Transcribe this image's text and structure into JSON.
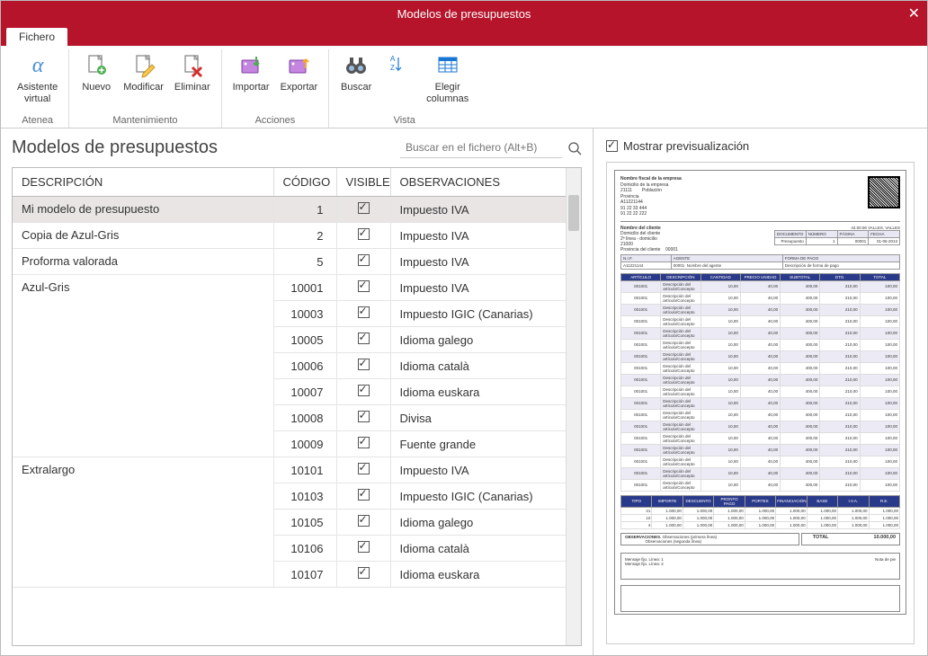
{
  "window": {
    "title": "Modelos de presupuestos"
  },
  "tab": {
    "label": "Fichero"
  },
  "ribbon": {
    "groups": [
      {
        "label": "Atenea",
        "items": [
          {
            "label": "Asistente\nvirtual",
            "name": "assistant-button",
            "icon": "alpha-icon"
          }
        ]
      },
      {
        "label": "Mantenimiento",
        "items": [
          {
            "label": "Nuevo",
            "name": "new-button",
            "icon": "new-icon"
          },
          {
            "label": "Modificar",
            "name": "edit-button",
            "icon": "edit-icon"
          },
          {
            "label": "Eliminar",
            "name": "delete-button",
            "icon": "delete-icon"
          }
        ]
      },
      {
        "label": "Acciones",
        "items": [
          {
            "label": "Importar",
            "name": "import-button",
            "icon": "import-icon"
          },
          {
            "label": "Exportar",
            "name": "export-button",
            "icon": "export-icon"
          }
        ]
      },
      {
        "label": "Vista",
        "items": [
          {
            "label": "Buscar",
            "name": "search-button",
            "icon": "binoculars-icon"
          },
          {
            "label": "",
            "name": "sort-button",
            "icon": "sort-icon"
          },
          {
            "label": "Elegir\ncolumnas",
            "name": "columns-button",
            "icon": "columns-icon"
          }
        ]
      }
    ]
  },
  "page": {
    "title": "Modelos de presupuestos"
  },
  "search": {
    "placeholder": "Buscar en el fichero (Alt+B)"
  },
  "table": {
    "headers": {
      "desc": "DESCRIPCIÓN",
      "code": "CÓDIGO",
      "visible": "VISIBLE",
      "obs": "OBSERVACIONES"
    },
    "rows": [
      {
        "desc": "Mi modelo de presupuesto",
        "code": "1",
        "visible": true,
        "obs": "Impuesto IVA",
        "rowspan": 1,
        "selected": true
      },
      {
        "desc": "Copia de Azul-Gris",
        "code": "2",
        "visible": true,
        "obs": "Impuesto IVA",
        "rowspan": 1
      },
      {
        "desc": "Proforma valorada",
        "code": "5",
        "visible": true,
        "obs": "Impuesto IVA",
        "rowspan": 1
      },
      {
        "desc": "Azul-Gris",
        "group": true,
        "children": [
          {
            "code": "10001",
            "visible": true,
            "obs": "Impuesto IVA"
          },
          {
            "code": "10003",
            "visible": true,
            "obs": "Impuesto IGIC (Canarias)"
          },
          {
            "code": "10005",
            "visible": true,
            "obs": "Idioma galego"
          },
          {
            "code": "10006",
            "visible": true,
            "obs": "Idioma català"
          },
          {
            "code": "10007",
            "visible": true,
            "obs": "Idioma euskara"
          },
          {
            "code": "10008",
            "visible": true,
            "obs": "Divisa"
          },
          {
            "code": "10009",
            "visible": true,
            "obs": "Fuente grande"
          }
        ]
      },
      {
        "desc": "Extralargo",
        "group": true,
        "children": [
          {
            "code": "10101",
            "visible": true,
            "obs": "Impuesto IVA"
          },
          {
            "code": "10103",
            "visible": true,
            "obs": "Impuesto IGIC (Canarias)"
          },
          {
            "code": "10105",
            "visible": true,
            "obs": "Idioma galego"
          },
          {
            "code": "10106",
            "visible": true,
            "obs": "Idioma català"
          },
          {
            "code": "10107",
            "visible": true,
            "obs": "Idioma euskara"
          }
        ]
      }
    ]
  },
  "preview": {
    "checkbox_label": "Mostrar previsualización",
    "company": {
      "name": "Nombre fiscal de la empresa",
      "addr": "Domicilio de la empresa",
      "zip": "21111",
      "pob": "Población",
      "prov": "Provincia",
      "cif": "A11221144",
      "tel1": "91 22 33 444",
      "tel2": "91 22 22 222"
    },
    "client": {
      "name": "Nombre del cliente",
      "addr": "Domicilio del cliente",
      "extra": "2ª línea - domicilio",
      "zip": "21000",
      "prov": "Provincia del cliente",
      "code": "00001",
      "city": "44.00.06 VALLES, VALLES"
    },
    "doc": {
      "h1": "DOCUMENTO",
      "h2": "NÚMERO",
      "h3": "PÁGINA",
      "h4": "FECHA",
      "v1": "Presupuesto",
      "v2": "1",
      "v3": "00001",
      "v4": "01-06-2013"
    },
    "agent": {
      "h1": "N.I.F.",
      "h2": "AGENTE",
      "h3": "FORMA DE PAGO",
      "v1": "A11221144",
      "v2": "00001",
      "v3": "Nombre del agente",
      "v4": "Descripción de forma de pago"
    },
    "lines_headers": [
      "ARTÍCULO",
      "DESCRIPCIÓN",
      "CANTIDAD",
      "PRECIO UNIDAD",
      "SUBTOTAL",
      "DTO.",
      "TOTAL"
    ],
    "lines_count": 18,
    "line_cells": [
      "001001",
      "Descripción del artículo/Concepto",
      "10,00",
      "40,00",
      "400,00",
      "210,00",
      "100,00"
    ],
    "totals_headers": [
      "TIPO",
      "IMPORTE",
      "DESCUENTO",
      "PRONTO PAGO",
      "PORTES",
      "FINANCIACIÓN",
      "BASE",
      "I.V.A.",
      "R.E."
    ],
    "totals_rows": [
      [
        "21",
        "1.000,00",
        "1.000,00",
        "1.000,00",
        "1.000,00",
        "1.000,00",
        "1.000,00",
        "1.000,00",
        "1.000,00"
      ],
      [
        "10",
        "1.000,00",
        "1.000,00",
        "1.000,00",
        "1.000,00",
        "1.000,00",
        "1.000,00",
        "1.000,00",
        "1.000,00"
      ],
      [
        "4",
        "1.000,00",
        "1.000,00",
        "1.000,00",
        "1.000,00",
        "1.000,00",
        "1.000,00",
        "1.000,00",
        "1.000,00"
      ]
    ],
    "obs_label": "OBSERVACIONES.",
    "obs1": "Observaciones (primera línea)",
    "obs2": "Observaciones (segunda línea)",
    "total_label": "TOTAL",
    "total_value": "10.000,00",
    "msg1": "Mensaje fijo. Línea: 1",
    "msg2": "Mensaje fijo. Línea: 2",
    "nota": "Nota de pie"
  }
}
